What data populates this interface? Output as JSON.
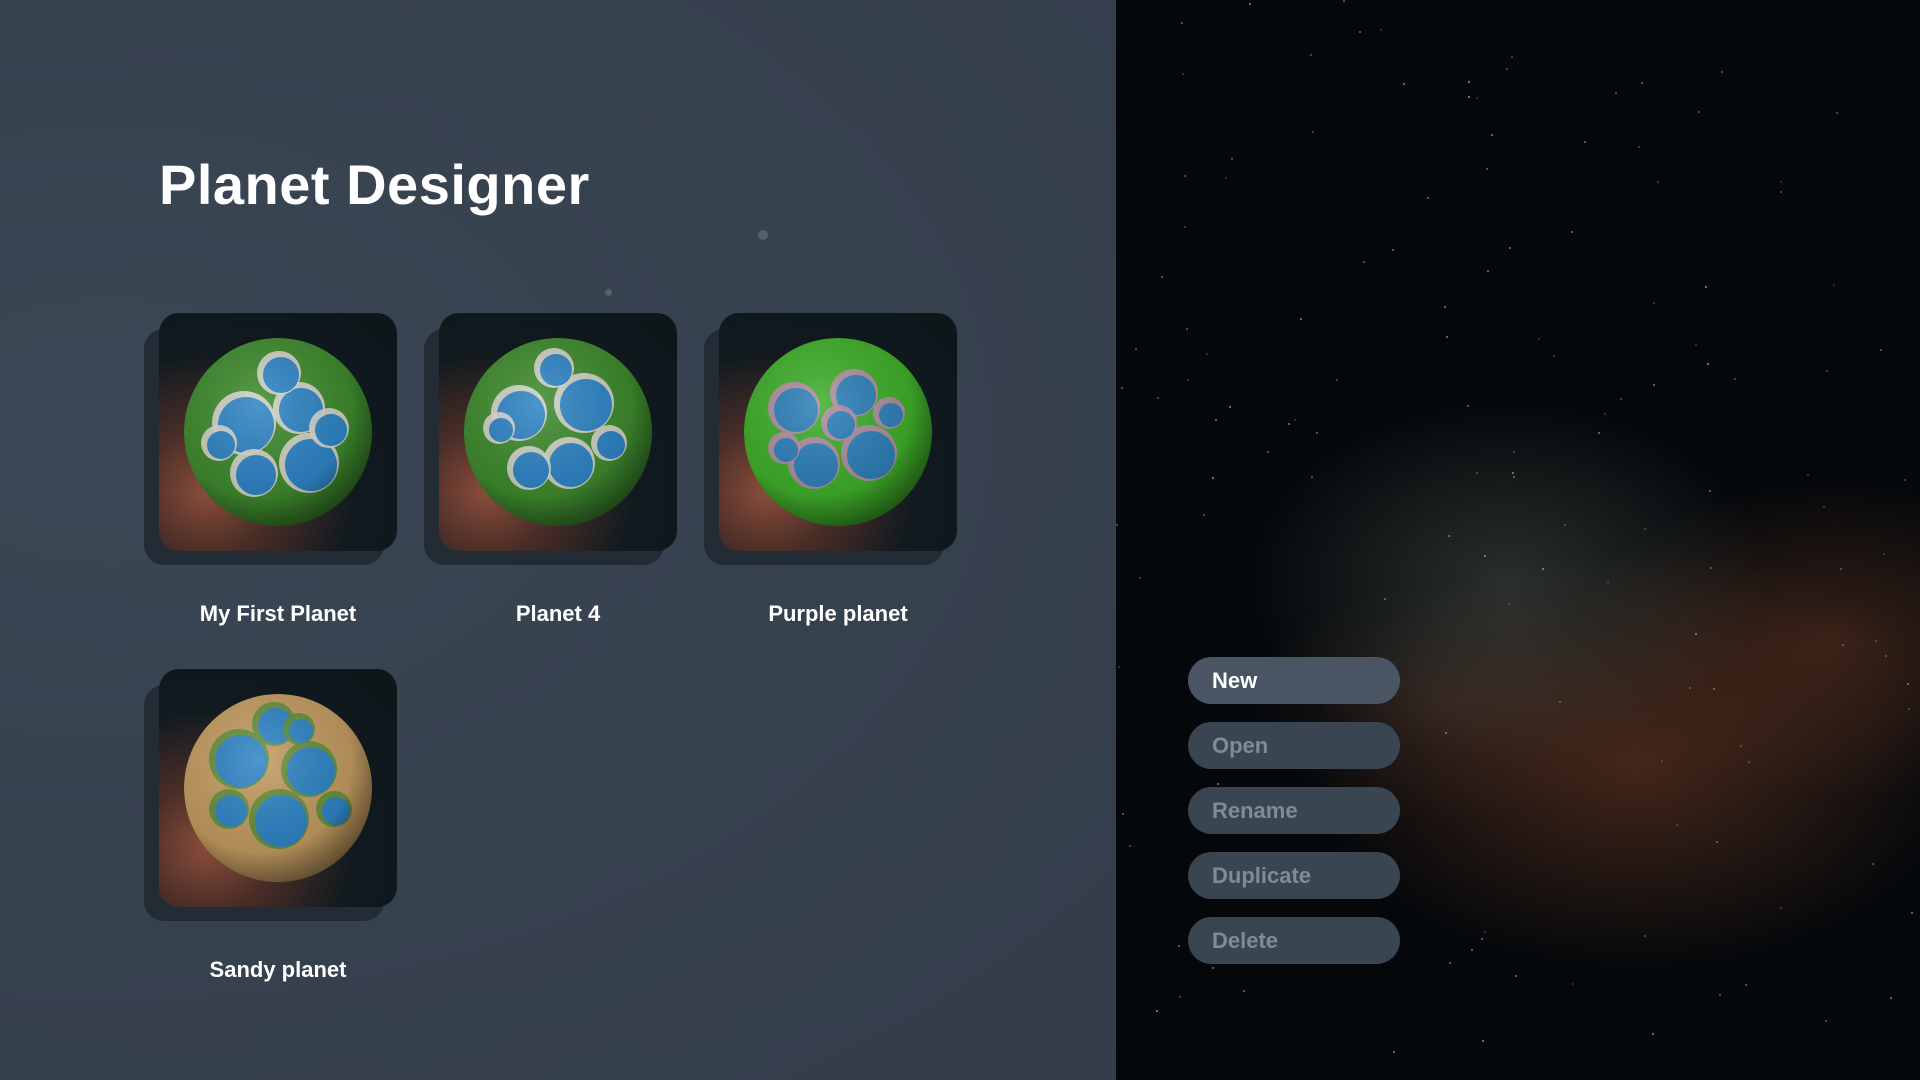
{
  "app": {
    "title": "Planet Designer"
  },
  "planets": [
    {
      "name": "My First Planet",
      "land_color": "#3e8a2e",
      "ocean_color": "#2e83c4",
      "snow_color": "#d9d6cf"
    },
    {
      "name": "Planet 4",
      "land_color": "#3e8a2e",
      "ocean_color": "#2e83c4",
      "snow_color": "#d9d6cf"
    },
    {
      "name": "Purple planet",
      "land_color": "#3fae2a",
      "ocean_color": "#2c7fb8",
      "snow_color": "#b88aa8"
    },
    {
      "name": "Sandy planet",
      "land_color": "#c29b60",
      "ocean_color": "#2e83c4",
      "snow_color": "#5d8e3a"
    }
  ],
  "menu": {
    "new_label": "New",
    "open_label": "Open",
    "rename_label": "Rename",
    "duplicate_label": "Duplicate",
    "delete_label": "Delete"
  },
  "colors": {
    "panel_bg": "#384350",
    "button_active_bg": "#4a5563",
    "button_inactive_bg": "#3a4552",
    "button_inactive_text": "#7f8b98"
  }
}
